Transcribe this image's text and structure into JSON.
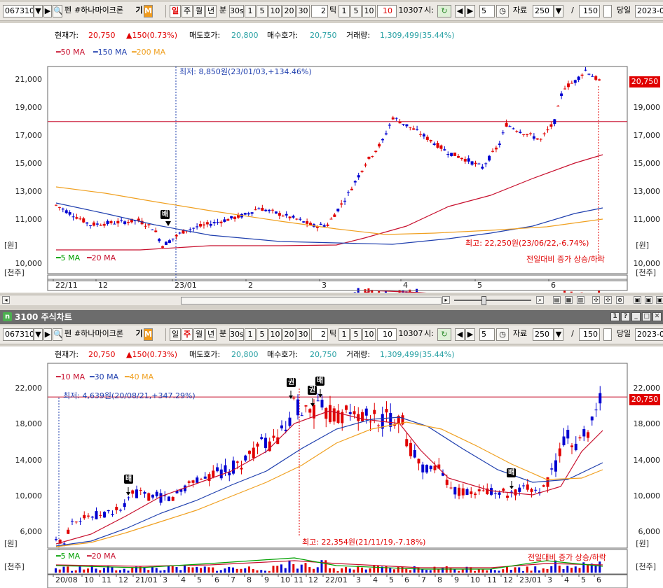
{
  "top": {
    "toolbar": {
      "code": "067310",
      "name": "#하나마이크론",
      "badge_gi": "기",
      "badge_m": "M",
      "pen": "펜",
      "periods": [
        "일",
        "주",
        "월",
        "년",
        "분"
      ],
      "active_period": "일",
      "intervals": [
        "30s",
        "1",
        "5",
        "10",
        "20",
        "30"
      ],
      "tick_value": "2",
      "tick_label": "틱",
      "tick_intervals": [
        "1",
        "5",
        "10"
      ],
      "tick_active": "10",
      "time_value": "10307",
      "time_label": "시:",
      "step_value": "5",
      "data_label": "자료",
      "data_count": "250",
      "slash": "/",
      "total": "150",
      "same_day": "당일",
      "date": "2023-0"
    },
    "info": {
      "cur_label": "현재가:",
      "cur_value": "20,750",
      "change": "▲150(0.73%)",
      "ask_label": "매도호가:",
      "ask_value": "20,800",
      "bid_label": "매수호가:",
      "bid_value": "20,750",
      "vol_label": "거래량:",
      "vol_value": "1,309,499(35.44%)"
    },
    "legend": [
      "50 MA",
      "150 MA",
      "200 MA"
    ],
    "y_ticks": [
      "21,000",
      "19,000",
      "17,000",
      "15,000",
      "13,000",
      "11,000"
    ],
    "unit_won": "[원]",
    "vol_legend": [
      "5 MA",
      "20 MA"
    ],
    "vol_tick": "10,000",
    "unit_vol": "[천주]",
    "vol_note": "전일대비 증가 상승/하락",
    "price_box": "20,750",
    "low_note": "최저: 8,850원(23/01/03,+134.46%)",
    "high_note": "최고: 22,250원(23/06/22,-6.74%)",
    "badge": "배",
    "x_labels": [
      "22/11",
      "12",
      "23/01",
      "2",
      "3",
      "4",
      "5",
      "6"
    ]
  },
  "header": {
    "title": "3100 주식차트",
    "icon": "n",
    "win_buttons": [
      "1",
      "?",
      "_",
      "□",
      "✕"
    ]
  },
  "bottom": {
    "toolbar": {
      "code": "067310",
      "name": "#하나마이크론",
      "badge_gi": "기",
      "badge_m": "M",
      "pen": "펜",
      "periods": [
        "일",
        "주",
        "월",
        "년",
        "분"
      ],
      "active_period": "주",
      "intervals": [
        "30s",
        "1",
        "5",
        "10",
        "20",
        "30"
      ],
      "tick_value": "2",
      "tick_label": "틱",
      "tick_intervals": [
        "1",
        "5",
        "10"
      ],
      "time_value": "10307",
      "time_label": "시:",
      "step_value": "5",
      "data_label": "자료",
      "data_count": "250",
      "slash": "/",
      "total": "150",
      "same_day": "당일",
      "date": "2023-0"
    },
    "info": {
      "cur_label": "현재가:",
      "cur_value": "20,750",
      "change": "▲150(0.73%)",
      "ask_label": "매도호가:",
      "ask_value": "20,800",
      "bid_label": "매수호가:",
      "bid_value": "20,750",
      "vol_label": "거래량:",
      "vol_value": "1,309,499(35.44%)"
    },
    "legend": [
      "10 MA",
      "30 MA",
      "40 MA"
    ],
    "y_ticks": [
      "22,000",
      "18,000",
      "14,000",
      "10,000",
      "6,000"
    ],
    "unit_won": "[원]",
    "vol_legend": [
      "5 MA",
      "20 MA"
    ],
    "unit_vol": "[천주]",
    "vol_note": "전일대비 증가 상승/하락",
    "price_box": "20,750",
    "low_note": "최저: 4,639원(20/08/21,+347.29%)",
    "high_note": "최고: 22,354원(21/11/19,-7.18%)",
    "badges": [
      "배",
      "권",
      "권",
      "배",
      "배"
    ],
    "x_labels": [
      "20/08",
      "10",
      "11",
      "12",
      "21/01",
      "3",
      "4",
      "5",
      "6",
      "7",
      "8",
      "9",
      "10",
      "11",
      "12",
      "22/01",
      "3",
      "4",
      "5",
      "6",
      "7",
      "8",
      "9",
      "10",
      "11",
      "12",
      "23/01",
      "3",
      "4",
      "5",
      "6"
    ]
  },
  "colors": {
    "ma_red": "#c8102e",
    "ma_blue": "#1f3fae",
    "ma_orange": "#f0a020",
    "up": "#e00000",
    "down": "#0000d0",
    "vol_ma_green": "#00a000"
  }
}
